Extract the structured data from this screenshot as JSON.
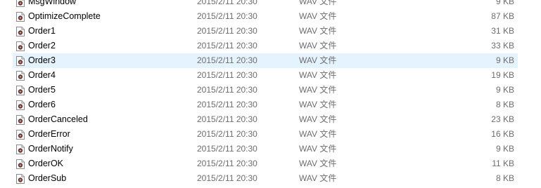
{
  "files": [
    {
      "name": "MsgWindow",
      "date": "2015/2/11 20:30",
      "type": "WAV 文件",
      "size": "9 KB",
      "selected": false
    },
    {
      "name": "OptimizeComplete",
      "date": "2015/2/11 20:30",
      "type": "WAV 文件",
      "size": "87 KB",
      "selected": false
    },
    {
      "name": "Order1",
      "date": "2015/2/11 20:30",
      "type": "WAV 文件",
      "size": "31 KB",
      "selected": false
    },
    {
      "name": "Order2",
      "date": "2015/2/11 20:30",
      "type": "WAV 文件",
      "size": "33 KB",
      "selected": false
    },
    {
      "name": "Order3",
      "date": "2015/2/11 20:30",
      "type": "WAV 文件",
      "size": "9 KB",
      "selected": true
    },
    {
      "name": "Order4",
      "date": "2015/2/11 20:30",
      "type": "WAV 文件",
      "size": "19 KB",
      "selected": false
    },
    {
      "name": "Order5",
      "date": "2015/2/11 20:30",
      "type": "WAV 文件",
      "size": "9 KB",
      "selected": false
    },
    {
      "name": "Order6",
      "date": "2015/2/11 20:30",
      "type": "WAV 文件",
      "size": "8 KB",
      "selected": false
    },
    {
      "name": "OrderCanceled",
      "date": "2015/2/11 20:30",
      "type": "WAV 文件",
      "size": "23 KB",
      "selected": false
    },
    {
      "name": "OrderError",
      "date": "2015/2/11 20:30",
      "type": "WAV 文件",
      "size": "16 KB",
      "selected": false
    },
    {
      "name": "OrderNotify",
      "date": "2015/2/11 20:30",
      "type": "WAV 文件",
      "size": "9 KB",
      "selected": false
    },
    {
      "name": "OrderOK",
      "date": "2015/2/11 20:30",
      "type": "WAV 文件",
      "size": "11 KB",
      "selected": false
    },
    {
      "name": "OrderSub",
      "date": "2015/2/11 20:30",
      "type": "WAV 文件",
      "size": "8 KB",
      "selected": false
    }
  ],
  "icon": "wav-file-icon",
  "colors": {
    "selection": "#e5f3ff",
    "secondary_text": "#6d6d6d"
  }
}
